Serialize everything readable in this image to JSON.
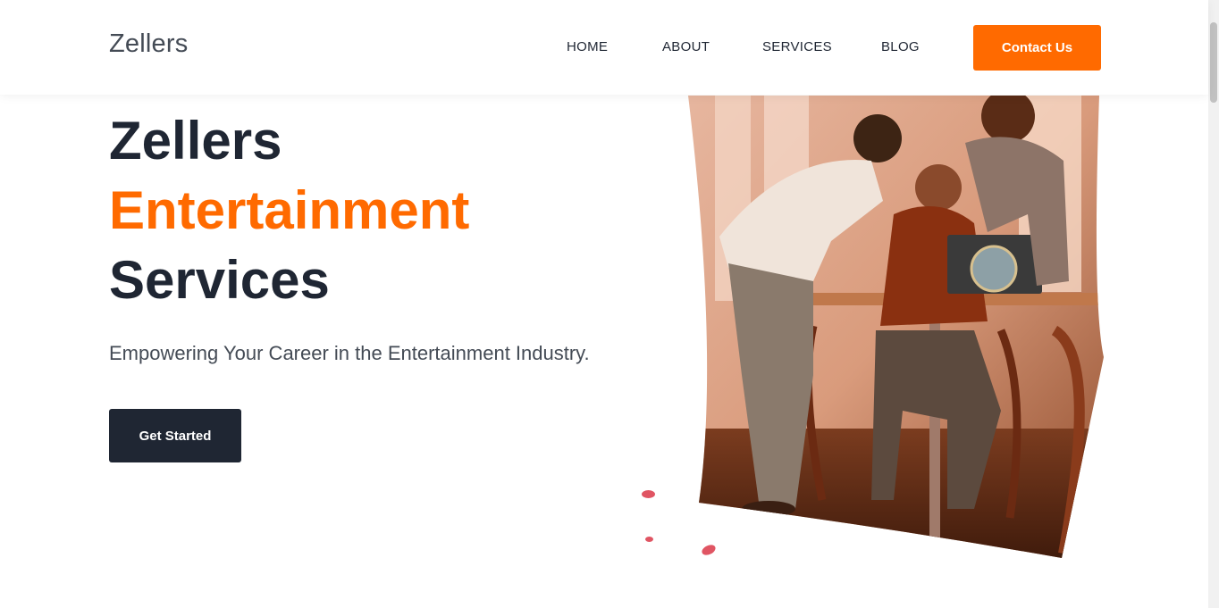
{
  "header": {
    "brand": "Zellers",
    "nav": [
      {
        "label": "HOME"
      },
      {
        "label": "ABOUT"
      },
      {
        "label": "SERVICES"
      },
      {
        "label": "BLOG"
      }
    ],
    "contact_label": "Contact Us"
  },
  "hero": {
    "title_line1": "Zellers",
    "title_line2": "Entertainment",
    "title_line3": "Services",
    "subtitle": "Empowering Your Career in the Entertainment Industry.",
    "cta_label": "Get Started",
    "image_label": "team-meeting-photo"
  },
  "colors": {
    "accent": "#ff6a00",
    "dark": "#1f2633",
    "decor_dot": "#e05563"
  }
}
